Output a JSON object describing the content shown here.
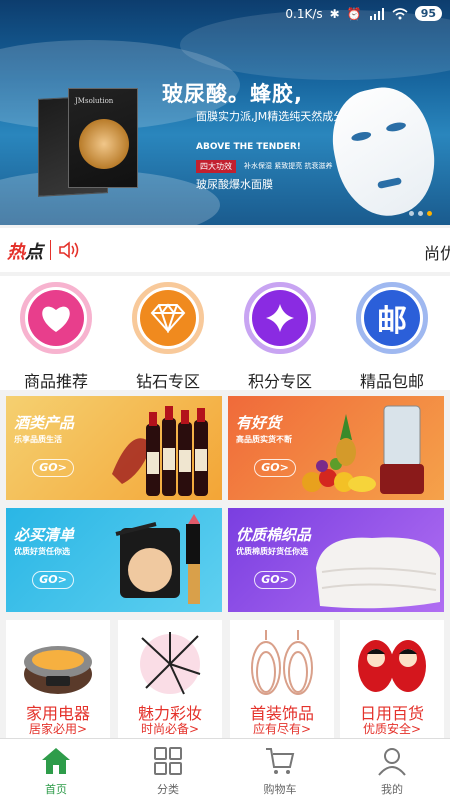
{
  "status_bar": {
    "speed": "0.1K/s",
    "battery": "95"
  },
  "banner": {
    "title": "玻尿酸。蜂胶,",
    "subtitle": "面膜实力派,JM精选纯天然成分!",
    "tagline": "ABOVE THE TENDER!",
    "badge": "四大功效",
    "features": "补水保湿 紧致提亮 抗衰滋养",
    "product": "玻尿酸爆水面膜",
    "brand": "JMsolution"
  },
  "hot": {
    "label_a": "热",
    "label_b": "点",
    "news": "尚优"
  },
  "categories": [
    {
      "label": "商品推荐",
      "color": "#e83e8c",
      "icon": "heart-icon"
    },
    {
      "label": "钻石专区",
      "color": "#f08a1e",
      "icon": "diamond-icon"
    },
    {
      "label": "积分专区",
      "color": "#8a2be2",
      "icon": "diamond-shape-icon"
    },
    {
      "label": "精品包邮",
      "color": "#2b5fd9",
      "icon": "you-icon",
      "icon_text": "邮"
    }
  ],
  "promos": [
    {
      "title": "酒类产品",
      "subtitle": "乐享品质生活",
      "go": "GO>"
    },
    {
      "title": "有好货",
      "subtitle": "高品质实货不断",
      "go": "GO>"
    },
    {
      "title": "必买清单",
      "subtitle": "优质好货任你选",
      "go": "GO>"
    },
    {
      "title": "优质棉织品",
      "subtitle": "优质棉质好货任你选",
      "go": "GO>"
    }
  ],
  "tiles": [
    {
      "title": "家用电器",
      "subtitle": "居家必用>"
    },
    {
      "title": "魅力彩妆",
      "subtitle": "时尚必备>"
    },
    {
      "title": "首装饰品",
      "subtitle": "应有尽有>"
    },
    {
      "title": "日用百货",
      "subtitle": "优质安全>"
    }
  ],
  "tabs": [
    {
      "label": "首页",
      "icon": "home-icon"
    },
    {
      "label": "分类",
      "icon": "grid-icon"
    },
    {
      "label": "购物车",
      "icon": "cart-icon"
    },
    {
      "label": "我的",
      "icon": "user-icon"
    }
  ],
  "colors": {
    "accent_green": "#2e9c4a",
    "hot_red": "#e4322b"
  }
}
